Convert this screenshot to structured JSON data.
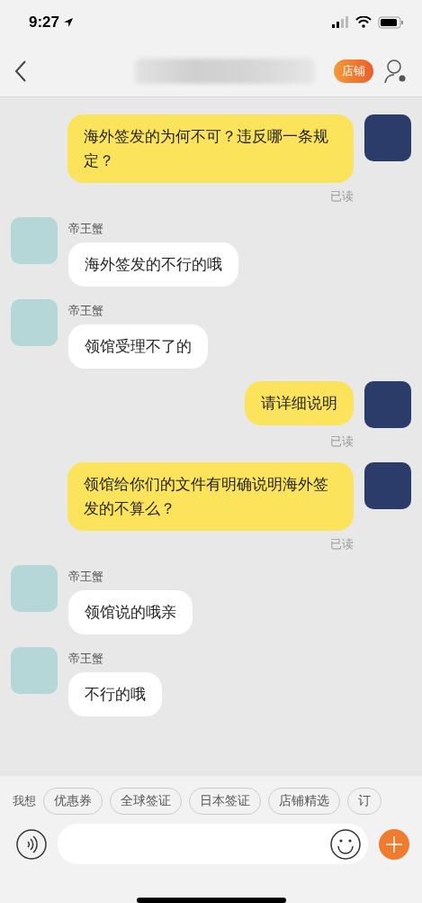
{
  "status_bar": {
    "time": "9:27"
  },
  "nav_bar": {
    "shop_button": "店铺"
  },
  "messages": [
    {
      "kind": "sent",
      "text": "海外签发的为何不可？违反哪一条规定？",
      "status": "已读"
    },
    {
      "kind": "received",
      "sender": "帝王蟹",
      "text": "海外签发的不行的哦"
    },
    {
      "kind": "received",
      "sender": "帝王蟹",
      "text": "领馆受理不了的"
    },
    {
      "kind": "sent",
      "text": "请详细说明",
      "status": "已读"
    },
    {
      "kind": "sent",
      "text": "领馆给你们的文件有明确说明海外签发的不算么？",
      "status": "已读"
    },
    {
      "kind": "received",
      "sender": "帝王蟹",
      "text": "领馆说的哦亲"
    },
    {
      "kind": "received",
      "sender": "帝王蟹",
      "text": "不行的哦"
    }
  ],
  "suggestions": {
    "label": "我想",
    "chips": [
      "优惠券",
      "全球签证",
      "日本签证",
      "店铺精选",
      "订"
    ]
  }
}
